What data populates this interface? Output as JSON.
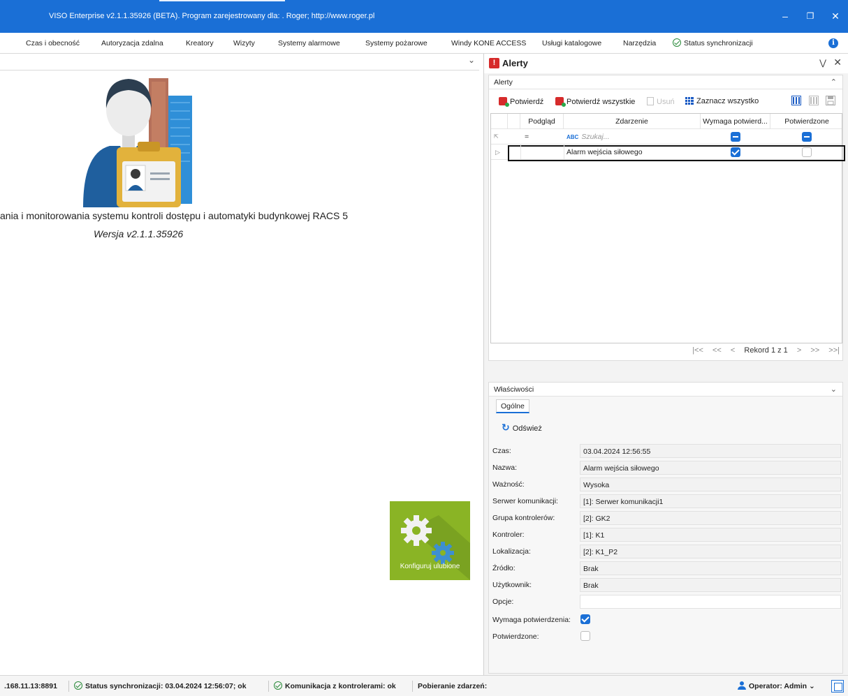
{
  "window": {
    "title": "VISO Enterprise v2.1.1.35926 (BETA). Program zarejestrowany dla: . Roger; http://www.roger.pl",
    "minimize_icon": "minimize-icon",
    "restore_icon": "restore-icon",
    "close_icon": "close-icon"
  },
  "menu": {
    "items": [
      "Czas i obecność",
      "Autoryzacja zdalna",
      "Kreatory",
      "Wizyty",
      "Systemy alarmowe",
      "Systemy pożarowe",
      "Windy KONE ACCESS",
      "Usługi katalogowe",
      "Narzędzia",
      "Status synchronizacji"
    ]
  },
  "main": {
    "description": "ania i monitorowania systemu kontroli dostępu i automatyki budynkowej RACS 5",
    "version": "Wersja v2.1.1.35926",
    "favorites_tile": "Konfiguruj ulubione"
  },
  "alerts_panel": {
    "title": "Alerty",
    "group_title": "Alerty",
    "toolbar": {
      "confirm": "Potwierdź",
      "confirm_all": "Potwierdź wszystkie",
      "delete": "Usuń",
      "select_all": "Zaznacz wszystko"
    },
    "columns": [
      "Podgląd",
      "Zdarzenie",
      "Wymaga potwierd...",
      "Potwierdzone"
    ],
    "filter_row": {
      "search_placeholder": "Szukaj...",
      "preview_operator": "="
    },
    "rows": [
      {
        "event": "Alarm wejścia siłowego",
        "requires_confirmation": true,
        "confirmed": false
      }
    ],
    "pager": {
      "first": "|<<",
      "prev_page": "<<",
      "prev": "<",
      "record_text": "Rekord 1 z 1",
      "next": ">",
      "next_page": ">>",
      "last": ">>|"
    }
  },
  "properties": {
    "group_title": "Właściwości",
    "tab": "Ogólne",
    "refresh": "Odśwież",
    "fields": [
      {
        "label": "Czas:",
        "value": "03.04.2024 12:56:55"
      },
      {
        "label": "Nazwa:",
        "value": "Alarm wejścia siłowego"
      },
      {
        "label": "Ważność:",
        "value": "Wysoka"
      },
      {
        "label": "Serwer komunikacji:",
        "value": "[1]: Serwer komunikacji1"
      },
      {
        "label": "Grupa kontrolerów:",
        "value": "[2]: GK2"
      },
      {
        "label": "Kontroler:",
        "value": "[1]: K1"
      },
      {
        "label": "Lokalizacja:",
        "value": "[2]: K1_P2"
      },
      {
        "label": "Źródło:",
        "value": "Brak"
      },
      {
        "label": "Użytkownik:",
        "value": "Brak"
      },
      {
        "label": "Opcje:",
        "value": ""
      }
    ],
    "requires_confirmation_label": "Wymaga potwierdzenia:",
    "requires_confirmation": true,
    "confirmed_label": "Potwierdzone:",
    "confirmed": false
  },
  "statusbar": {
    "address": ".168.11.13:8891",
    "sync_status": "Status synchronizacji: 03.04.2024 12:56:07; ok",
    "controllers_comm": "Komunikacja z kontrolerami: ok",
    "fetching_events": "Pobieranie zdarzeń:",
    "operator": "Operator: Admin"
  },
  "colors": {
    "titlebar": "#1a6fd6",
    "accent": "#1a6fd6",
    "alert_red": "#d62b2b",
    "tile_green": "#8ab425"
  }
}
